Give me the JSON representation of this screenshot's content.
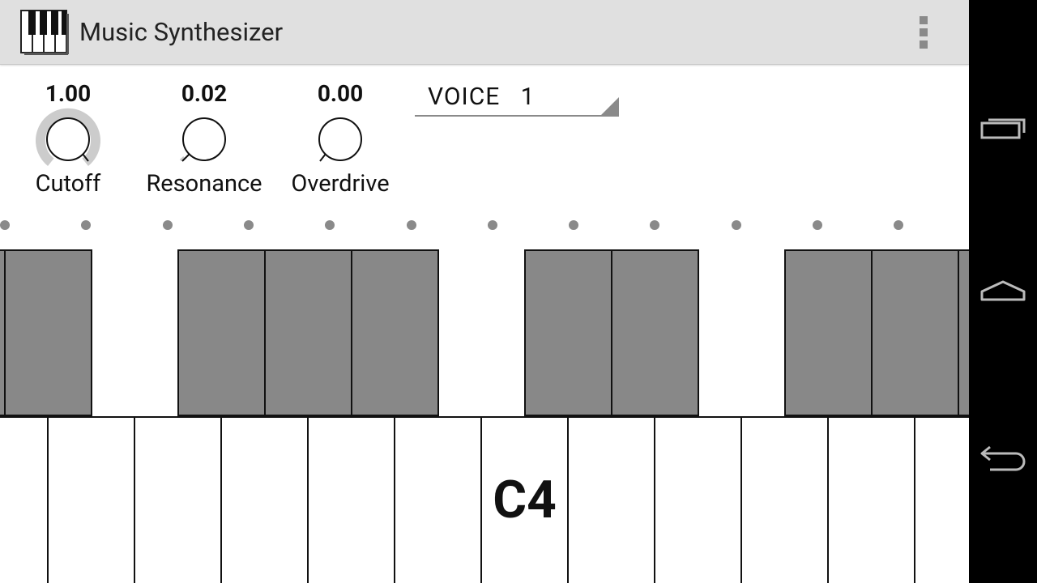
{
  "app": {
    "title": "Music Synthesizer",
    "icon": "piano-icon",
    "overflow_icon": "overflow-menu-icon"
  },
  "knobs": [
    {
      "id": "cutoff",
      "value": "1.00",
      "label": "Cutoff",
      "level": 1.0
    },
    {
      "id": "resonance",
      "value": "0.02",
      "label": "Resonance",
      "level": 0.02
    },
    {
      "id": "overdrive",
      "value": "0.00",
      "label": "Overdrive",
      "level": 0.0
    }
  ],
  "voice": {
    "label": "VOICE   1"
  },
  "keyboard": {
    "marked_key_label": "C4",
    "dot_count": 12
  },
  "nav_bar": {
    "recent_apps_icon": "recent-apps-icon",
    "home_icon": "home-icon",
    "back_icon": "back-icon"
  },
  "colors": {
    "action_bar": "#e0e0e0",
    "black_key": "#888888",
    "knob_track": "#cccccc",
    "accent_gray": "#8a8a8a",
    "nav_bar": "#000000"
  }
}
